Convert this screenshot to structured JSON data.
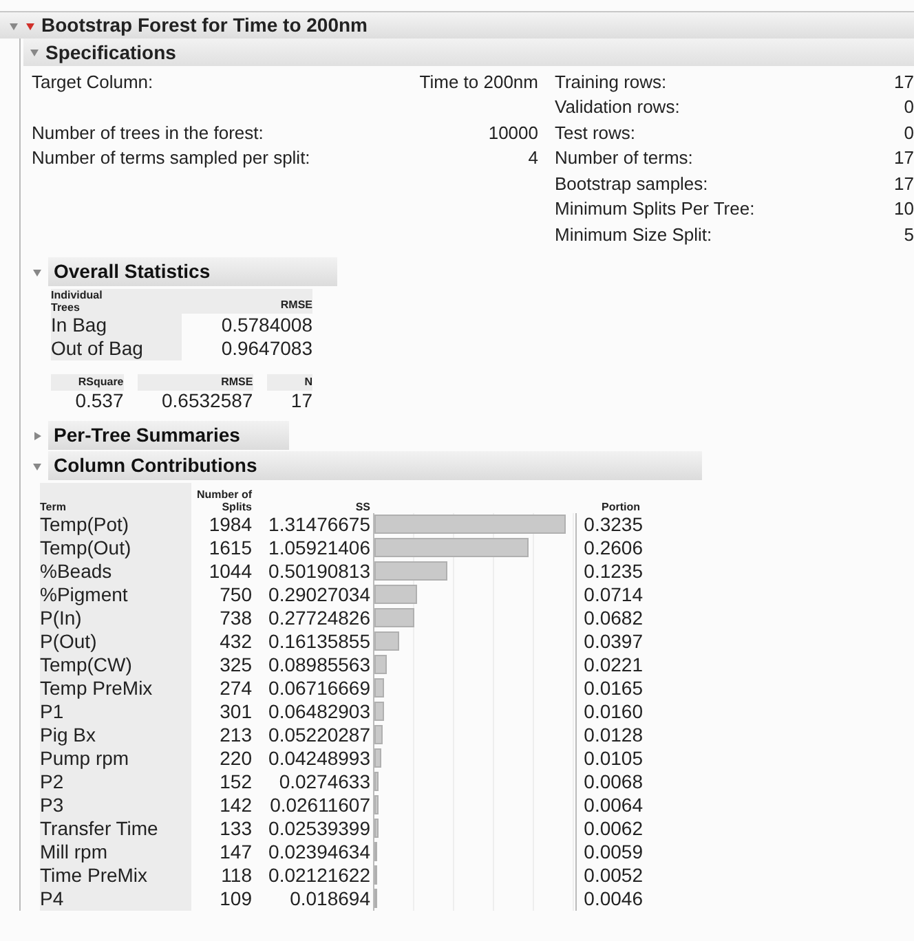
{
  "report": {
    "title": "Bootstrap Forest for Time to 200nm",
    "expanded": true,
    "specifications": {
      "title": "Specifications",
      "expanded": true,
      "rows": [
        {
          "left_label": "Target Column:",
          "left_value": "Time to 200nm",
          "right_label": "Training rows:",
          "right_value": "17"
        },
        {
          "right_label": "Validation rows:",
          "right_value": "0"
        },
        {
          "left_label": "Number of trees in the forest:",
          "left_value": "10000",
          "right_label": "Test rows:",
          "right_value": "0"
        },
        {
          "left_label": "Number of terms sampled per split:",
          "left_value": "4",
          "right_label": "Number of terms:",
          "right_value": "17"
        },
        {
          "right_label": "Bootstrap samples:",
          "right_value": "17"
        },
        {
          "right_label": "Minimum Splits Per Tree:",
          "right_value": "10"
        },
        {
          "right_label": "Minimum Size Split:",
          "right_value": "5"
        }
      ]
    },
    "overall_statistics": {
      "title": "Overall Statistics",
      "expanded": true,
      "individual_trees": {
        "columns": [
          "Individual Trees",
          "RMSE"
        ],
        "rows": [
          {
            "label": "In Bag",
            "rmse": "0.5784008"
          },
          {
            "label": "Out of Bag",
            "rmse": "0.9647083"
          }
        ]
      },
      "fit": {
        "columns": [
          "RSquare",
          "RMSE",
          "N"
        ],
        "values": [
          "0.537",
          "0.6532587",
          "17"
        ]
      }
    },
    "per_tree_summaries": {
      "title": "Per-Tree Summaries",
      "expanded": false
    },
    "column_contributions": {
      "title": "Column Contributions",
      "expanded": true,
      "columns": [
        "Term",
        "Number of Splits",
        "SS",
        "Portion"
      ],
      "rows": [
        {
          "term": "Temp(Pot)",
          "splits": "1984",
          "ss": "1.31476675",
          "level": 0.95,
          "portion": "0.3235"
        },
        {
          "term": "Temp(Out)",
          "splits": "1615",
          "ss": "1.05921406",
          "level": 0.77,
          "portion": "0.2606"
        },
        {
          "term": "%Beads",
          "splits": "1044",
          "ss": "0.50190813",
          "level": 0.36,
          "portion": "0.1235"
        },
        {
          "term": "%Pigment",
          "splits": "750",
          "ss": "0.29027034",
          "level": 0.21,
          "portion": "0.0714"
        },
        {
          "term": "P(In)",
          "splits": "738",
          "ss": "0.27724826",
          "level": 0.2,
          "portion": "0.0682"
        },
        {
          "term": "P(Out)",
          "splits": "432",
          "ss": "0.16135855",
          "level": 0.12,
          "portion": "0.0397"
        },
        {
          "term": "Temp(CW)",
          "splits": "325",
          "ss": "0.08985563",
          "level": 0.065,
          "portion": "0.0221"
        },
        {
          "term": "Temp PreMix",
          "splits": "274",
          "ss": "0.06716669",
          "level": 0.05,
          "portion": "0.0165"
        },
        {
          "term": "P1",
          "splits": "301",
          "ss": "0.06482903",
          "level": 0.047,
          "portion": "0.0160"
        },
        {
          "term": "Pig Bx",
          "splits": "213",
          "ss": "0.05220287",
          "level": 0.038,
          "portion": "0.0128"
        },
        {
          "term": "Pump rpm",
          "splits": "220",
          "ss": "0.04248993",
          "level": 0.031,
          "portion": "0.0105"
        },
        {
          "term": "P2",
          "splits": "152",
          "ss": "0.0274633",
          "level": 0.02,
          "portion": "0.0068"
        },
        {
          "term": "P3",
          "splits": "142",
          "ss": "0.02611607",
          "level": 0.019,
          "portion": "0.0064"
        },
        {
          "term": "Transfer Time",
          "splits": "133",
          "ss": "0.02539399",
          "level": 0.018,
          "portion": "0.0062"
        },
        {
          "term": "Mill rpm",
          "splits": "147",
          "ss": "0.02394634",
          "level": 0.017,
          "portion": "0.0059"
        },
        {
          "term": "Time PreMix",
          "splits": "118",
          "ss": "0.02121622",
          "level": 0.015,
          "portion": "0.0052"
        },
        {
          "term": "P4",
          "splits": "109",
          "ss": "0.018694",
          "level": 0.013,
          "portion": "0.0046"
        }
      ]
    }
  }
}
